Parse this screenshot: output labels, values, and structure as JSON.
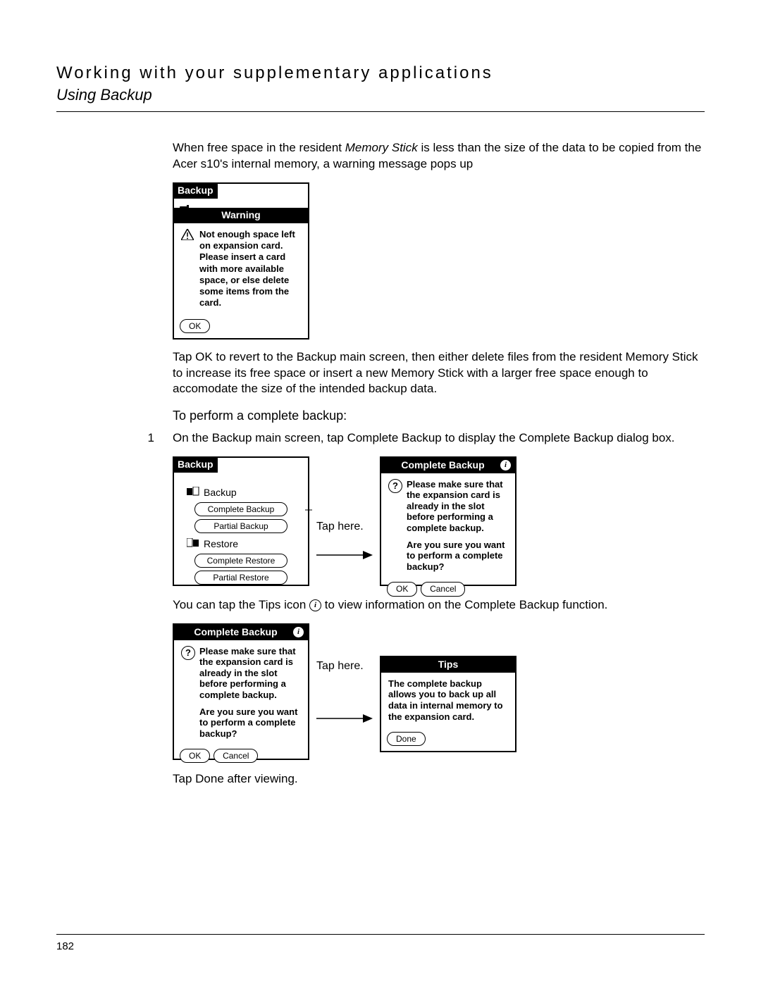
{
  "header": {
    "title": "Working with your supplementary applications",
    "subtitle": "Using Backup"
  },
  "intro_pre": "When free space in the resident ",
  "intro_em": "Memory Stick",
  "intro_post": " is less than the size of the data to be copied from the Acer s10's internal memory, a warning message pops up",
  "warning_dialog": {
    "title": "Backup",
    "bar": "Warning",
    "message": "Not enough space left on expansion card. Please insert a card with more available space, or else delete some items from the card.",
    "ok": "OK"
  },
  "after_warning": "Tap OK to revert to the Backup main screen, then either delete files from the resident Memory Stick to increase its free space or insert a new Memory Stick with a larger free space enough to accomodate the size of the intended backup data.",
  "section_sub": "To perform a complete backup:",
  "step1_num": "1",
  "step1_text": "On the Backup main screen, tap Complete Backup to display the Complete Backup dialog box.",
  "backup_main": {
    "title": "Backup",
    "backup_label": "Backup",
    "complete_backup": "Complete Backup",
    "partial_backup": "Partial Backup",
    "restore_label": "Restore",
    "complete_restore": "Complete Restore",
    "partial_restore": "Partial Restore"
  },
  "tap_here": "Tap here.",
  "complete_backup_dialog": {
    "title": "Complete Backup",
    "msg1": "Please make sure that the expansion card is already in the  slot before performing a complete backup.",
    "msg2": "Are you sure you want to perform a complete backup?",
    "ok": "OK",
    "cancel": "Cancel"
  },
  "tips_line_pre": "You can tap the Tips icon ",
  "tips_line_post": " to view information on the Complete Backup function.",
  "tips_dialog": {
    "title": "Tips",
    "text": "The complete backup allows you to back up all data in internal memory to the expansion card.",
    "done": "Done"
  },
  "tap_done": "Tap Done after viewing.",
  "page_number": "182"
}
